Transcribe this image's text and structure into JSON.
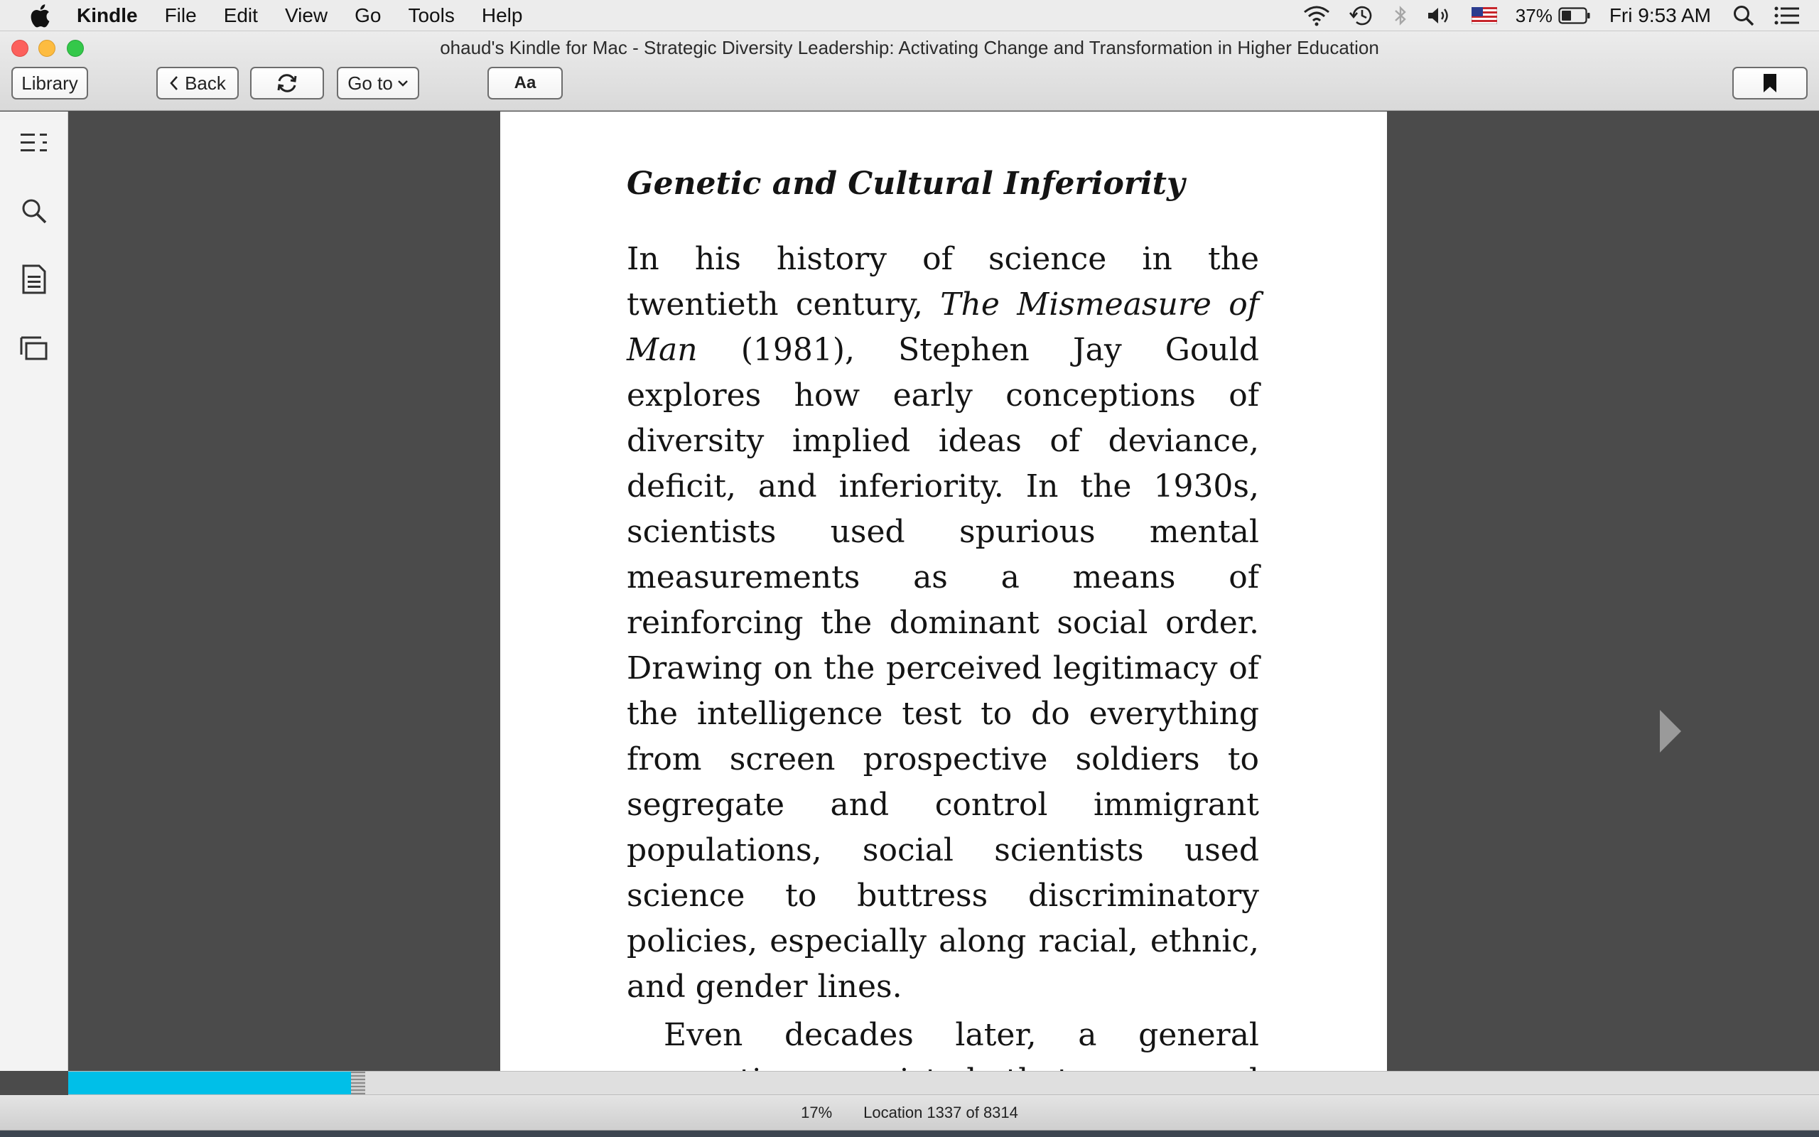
{
  "menubar": {
    "app_name": "Kindle",
    "menus": [
      "File",
      "Edit",
      "View",
      "Go",
      "Tools",
      "Help"
    ],
    "battery_percent": "37%",
    "clock": "Fri 9:53 AM"
  },
  "window": {
    "title": "ohaud's Kindle for Mac - Strategic Diversity Leadership: Activating Change and Transformation in Higher Education"
  },
  "toolbar": {
    "library_label": "Library",
    "back_label": "Back",
    "goto_label": "Go to",
    "font_label": "Aa"
  },
  "sidebar": {
    "icons": [
      "table-of-contents-icon",
      "search-icon",
      "notes-icon",
      "flashcards-icon"
    ]
  },
  "page": {
    "heading": "Genetic and Cultural Inferiority",
    "para1_before_title": "In his history of science in the twentieth century, ",
    "para1_title": "The Mismeasure of Man",
    "para1_after_title": " (1981), Stephen Jay Gould explores how early conceptions of diversity implied ideas of deviance, deficit, and inferiority. In the 1930s, scientists used spurious mental measurements as a means of reinforcing the dominant social order. Drawing on the perceived legitimacy of the intelligence test to do everything from screen prospective soldiers to segregate and control immigrant populations, social scientists used science to buttress discriminatory policies, especially along racial, ethnic, and gender lines.",
    "para2": "Even decades later, a general conception persisted that poor and"
  },
  "progress": {
    "fraction": 0.17,
    "percent_label": "17%",
    "location_label": "Location 1337 of 8314"
  },
  "colors": {
    "progress_fill": "#00bfe8",
    "reader_background": "#4b4b4b"
  }
}
